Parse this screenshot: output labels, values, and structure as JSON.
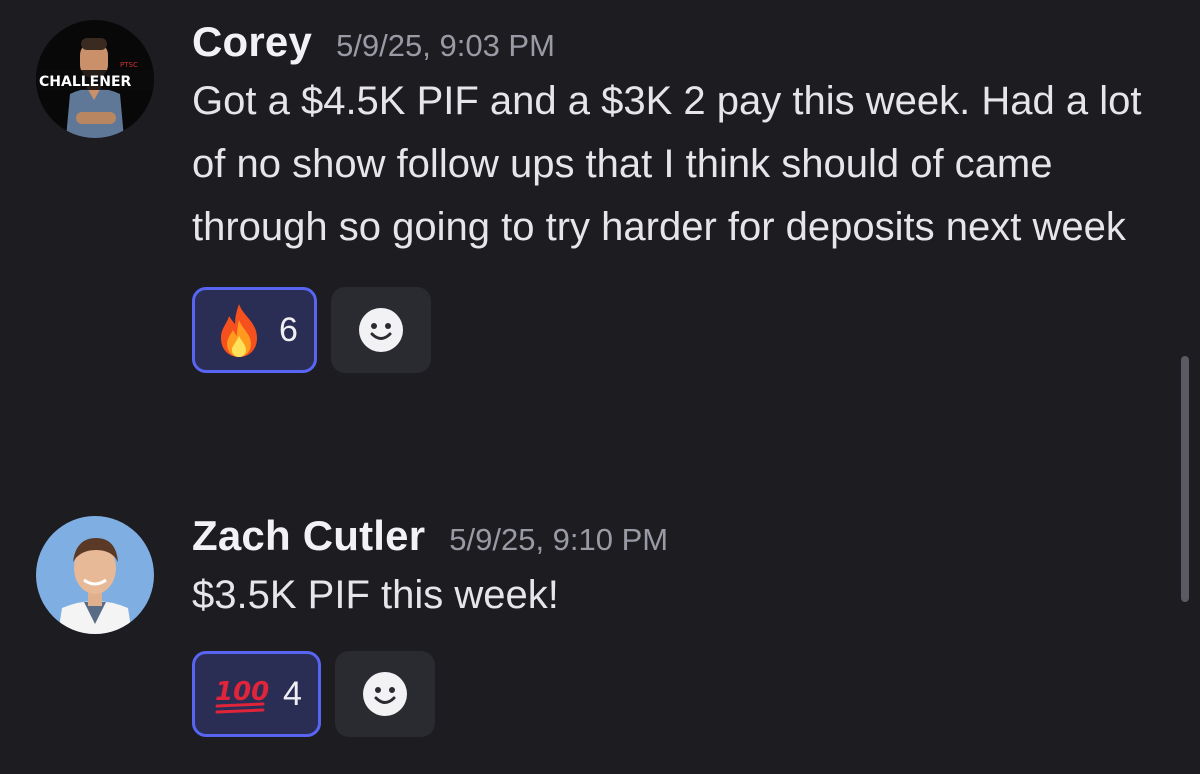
{
  "messages": [
    {
      "author": "Corey",
      "timestamp": "5/9/25, 9:03 PM",
      "text": "Got a $4.5K PIF and a $3K 2 pay this week. Had a lot of no show follow ups that I think should of came through so going to try harder for deposits next week",
      "avatar_text": "CHALLENER",
      "reaction": {
        "emoji": "fire-emoji",
        "count": "6"
      }
    },
    {
      "author": "Zach Cutler",
      "timestamp": "5/9/25, 9:10 PM",
      "text": "$3.5K PIF this week!",
      "reaction": {
        "emoji": "hundred-points-emoji",
        "count": "4"
      }
    }
  ],
  "colors": {
    "background": "#1c1c21",
    "reaction_active_bg": "#2a2d54",
    "reaction_active_border": "#5865f2",
    "timestamp": "#9a9aa5"
  }
}
